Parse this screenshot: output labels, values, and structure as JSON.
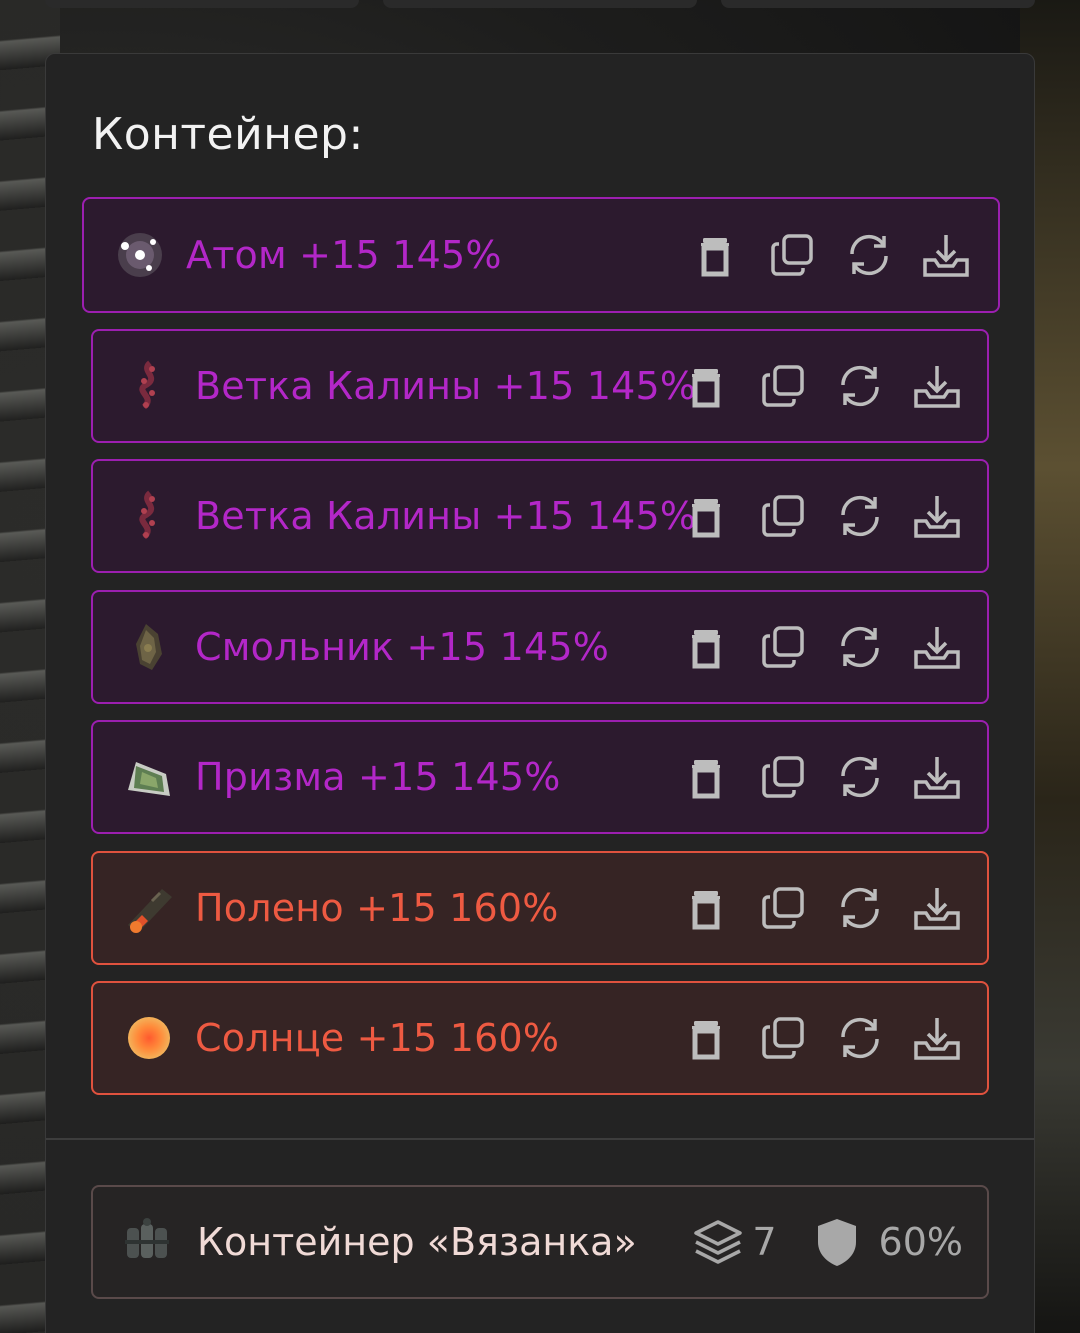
{
  "panel": {
    "title": "Контейнер:"
  },
  "items": [
    {
      "label": "Атом +15 145%",
      "rarity": "purple",
      "icon": "atom-artifact-icon"
    },
    {
      "label": "Ветка Калины +15 145%",
      "rarity": "purple",
      "icon": "viburnum-branch-artifact-icon"
    },
    {
      "label": "Ветка Калины +15 145%",
      "rarity": "purple",
      "icon": "viburnum-branch-artifact-icon"
    },
    {
      "label": "Смольник +15 145%",
      "rarity": "purple",
      "icon": "smolnik-artifact-icon"
    },
    {
      "label": "Призма +15 145%",
      "rarity": "purple",
      "icon": "prism-artifact-icon"
    },
    {
      "label": "Полено +15 160%",
      "rarity": "orange",
      "icon": "log-artifact-icon"
    },
    {
      "label": "Солнце +15 160%",
      "rarity": "orange",
      "icon": "sun-artifact-icon"
    }
  ],
  "actions": [
    "trash-icon",
    "copy-icon",
    "refresh-icon",
    "download-icon"
  ],
  "footer": {
    "label": "Контейнер «Вязанка»",
    "slots": "7",
    "protection": "60%"
  },
  "colors": {
    "purple_text": "#b327c8",
    "purple_border": "#9c1fb0",
    "orange_text": "#ee5a42",
    "orange_border": "#e0523e",
    "panel_bg": "#232323"
  }
}
